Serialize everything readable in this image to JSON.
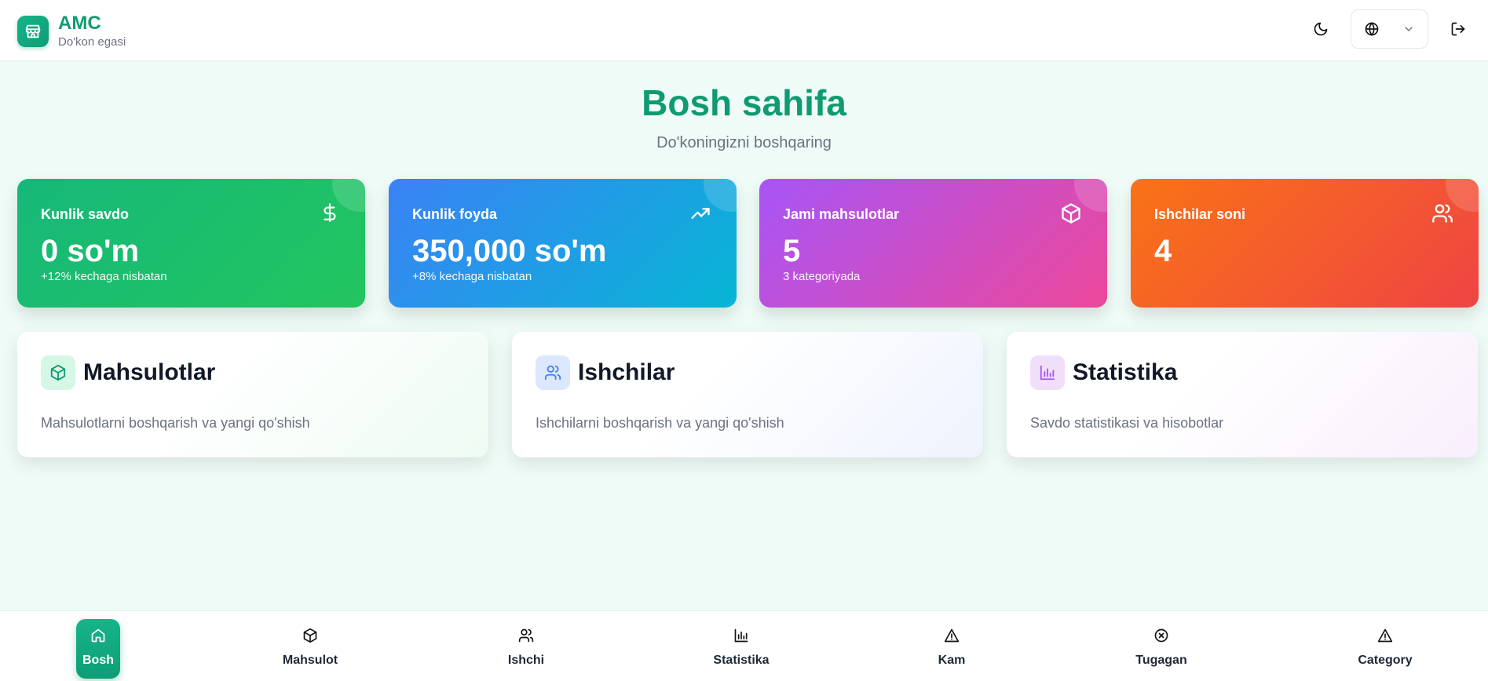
{
  "header": {
    "title": "AMC",
    "subtitle": "Do'kon egasi",
    "icons": [
      "store-icon",
      "moon-icon",
      "globe-icon",
      "chevron-down-icon",
      "logout-icon"
    ]
  },
  "main": {
    "title": "Bosh sahifa",
    "subtitle": "Do'koningizni boshqaring"
  },
  "stats": [
    {
      "label": "Kunlik savdo",
      "value": "0 so'm",
      "note": "+12% kechaga nisbatan",
      "icon": "dollar-icon",
      "colors": [
        "#16b87a",
        "#22c55e"
      ]
    },
    {
      "label": "Kunlik foyda",
      "value": "350,000 so'm",
      "note": "+8% kechaga nisbatan",
      "icon": "trending-up-icon",
      "colors": [
        "#3b82f6",
        "#06b6d4"
      ]
    },
    {
      "label": "Jami mahsulotlar",
      "value": "5",
      "note": "3 kategoriyada",
      "icon": "box-icon",
      "colors": [
        "#a855f7",
        "#ec4899"
      ]
    },
    {
      "label": "Ishchilar soni",
      "value": "4",
      "note": "",
      "icon": "users-icon",
      "colors": [
        "#f97316",
        "#ef4444"
      ]
    }
  ],
  "cards": [
    {
      "title": "Mahsulotlar",
      "desc": "Mahsulotlarni boshqarish va yangi qo'shish",
      "icon": "box-icon",
      "accent": "#0f9b72"
    },
    {
      "title": "Ishchilar",
      "desc": "Ishchilarni boshqarish va yangi qo'shish",
      "icon": "users-icon",
      "accent": "#3b82f6"
    },
    {
      "title": "Statistika",
      "desc": "Savdo statistikasi va hisobotlar",
      "icon": "bar-chart-icon",
      "accent": "#a855f7"
    }
  ],
  "nav": [
    {
      "label": "Bosh",
      "icon": "home-icon",
      "active": true
    },
    {
      "label": "Mahsulot",
      "icon": "box-icon"
    },
    {
      "label": "Ishchi",
      "icon": "users-icon"
    },
    {
      "label": "Statistika",
      "icon": "bar-chart-icon"
    },
    {
      "label": "Kam",
      "icon": "warning-icon"
    },
    {
      "label": "Tugagan",
      "icon": "x-circle-icon"
    },
    {
      "label": "Category",
      "icon": "warning-icon"
    }
  ]
}
